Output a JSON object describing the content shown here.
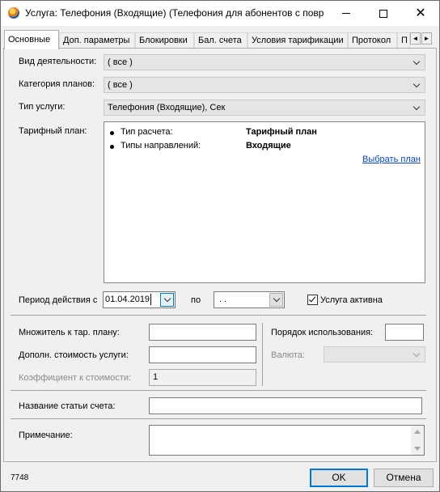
{
  "window": {
    "title": "Услуга: Телефония (Входящие) (Телефония для абонентов с повр...",
    "minimize_glyph": "—",
    "close_glyph": "✕"
  },
  "tabs": [
    {
      "label": "Основные"
    },
    {
      "label": "Доп. параметры"
    },
    {
      "label": "Блокировки"
    },
    {
      "label": "Бал. счета"
    },
    {
      "label": "Условия тарификации"
    },
    {
      "label": "Протокол"
    },
    {
      "label": "П"
    }
  ],
  "tab_nav": {
    "left": "◄",
    "right": "►"
  },
  "form": {
    "activity_label": "Вид деятельности:",
    "activity_value": "( все )",
    "plan_category_label": "Категория планов:",
    "plan_category_value": "( все )",
    "service_type_label": "Тип услуги:",
    "service_type_value": "Телефония (Входящие), Сек",
    "tariff_plan_label": "Тарифный план:",
    "tariff_plan_rows": [
      {
        "key": "Тип расчета:",
        "value": "Тарифный план"
      },
      {
        "key": "Типы направлений:",
        "value": "Входящие"
      }
    ],
    "choose_plan_link": "Выбрать план",
    "period_label": "Период действия с",
    "period_from": "01.04.2019",
    "period_to_label": "по",
    "period_to": ". .",
    "active_label": "Услуга активна",
    "active_checked": true,
    "multiplier_label": "Множитель к тар. плану:",
    "multiplier_value": "",
    "extra_cost_label": "Дополн. стоимость услуги:",
    "extra_cost_value": "",
    "cost_coef_label": "Коэффициент к стоимости:",
    "cost_coef_value": "1",
    "usage_order_label": "Порядок использования:",
    "usage_order_value": "",
    "currency_label": "Валюта:",
    "currency_value": "",
    "invoice_item_label": "Название статьи счета:",
    "invoice_item_value": "",
    "note_label": "Примечание:",
    "note_value": ""
  },
  "footer": {
    "id": "7748",
    "ok_label": "OK",
    "cancel_label": "Отмена"
  }
}
